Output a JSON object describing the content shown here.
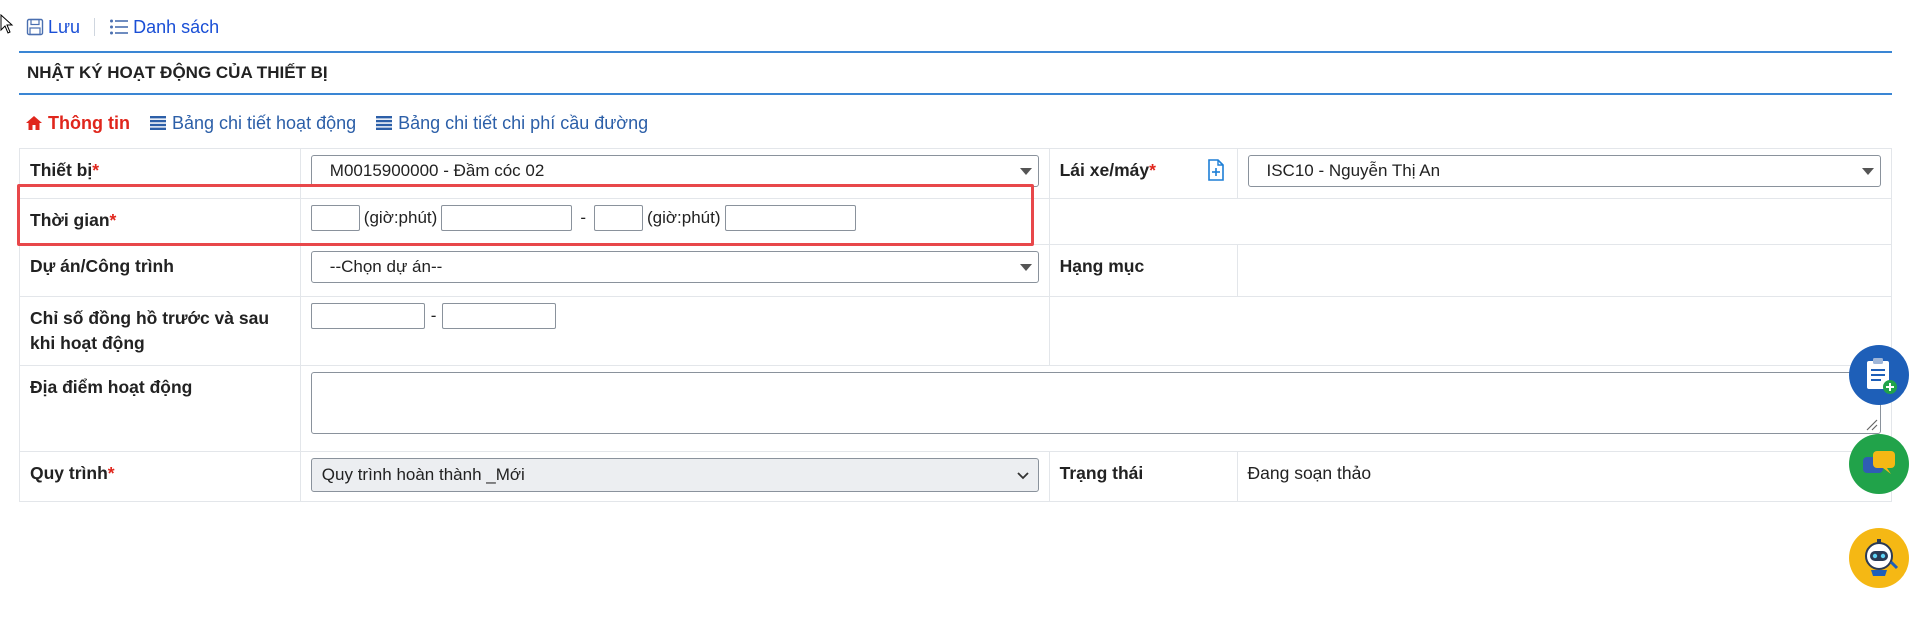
{
  "toolbar": {
    "save_label": "Lưu",
    "list_label": "Danh sách"
  },
  "page": {
    "title": "NHẬT KÝ HOẠT ĐỘNG CỦA THIẾT BỊ"
  },
  "tabs": [
    {
      "label": "Thông tin",
      "active": true
    },
    {
      "label": "Bảng chi tiết hoạt động",
      "active": false
    },
    {
      "label": "Bảng chi tiết chi phí cầu đường",
      "active": false
    }
  ],
  "form": {
    "device": {
      "label": "Thiết bị",
      "required_mark": "*",
      "value": "M0015900000 - Đầm cóc 02"
    },
    "driver": {
      "label": "Lái xe/máy",
      "required_mark": "*",
      "value": "ISC10 - Nguyễn Thị An"
    },
    "time": {
      "label": "Thời gian",
      "required_mark": "*",
      "unit_label": "(giờ:phút)",
      "separator": "-"
    },
    "project": {
      "label": "Dự án/Công trình",
      "value": "--Chọn dự án--"
    },
    "category": {
      "label": "Hạng mục"
    },
    "meter": {
      "label": "Chỉ số đồng hồ trước và sau khi hoạt động",
      "separator": "-"
    },
    "location": {
      "label": "Địa điểm hoạt động"
    },
    "workflow": {
      "label": "Quy trình",
      "required_mark": "*",
      "value": "Quy trình hoàn thành _Mới"
    },
    "status": {
      "label": "Trạng thái",
      "value": "Đang soạn thảo"
    }
  },
  "colors": {
    "accent": "#3a86d4",
    "required": "#e0261c",
    "link": "#1a4fd6",
    "highlight": "#e8474a"
  }
}
